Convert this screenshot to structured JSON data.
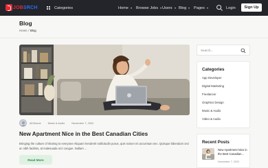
{
  "brand": {
    "logo_text_1": "JOB",
    "logo_text_2": "SRCH"
  },
  "nav": {
    "categories_label": "Categories",
    "items": [
      {
        "label": "Home"
      },
      {
        "label": "Browse Jobs"
      },
      {
        "label": "Users"
      },
      {
        "label": "Blog"
      },
      {
        "label": "Pages"
      }
    ],
    "login_label": "Login",
    "signup_label": "Sign Up"
  },
  "page": {
    "title": "Blog",
    "breadcrumb": {
      "home": "Home",
      "separator": "/",
      "current": "Blog"
    }
  },
  "post": {
    "author": "Ali Boone",
    "category": "Music & Audio",
    "date": "November 7, 2022",
    "title": "New Apartment Nice in the Best Canadian Cities",
    "excerpt": "Bringing the culture of sharing to everyone Aliquam hendrerit sollicitudin purus, quis rutrum mi accumsan nec. Quisque bibendum orci ac nibh facilisis, at malesuada orci congue. Nullam ...",
    "read_more_label": "Read More"
  },
  "sidebar": {
    "search_placeholder": "Search...",
    "categories_title": "Categories",
    "categories": [
      "App Developer",
      "Digital Marketing",
      "Freelancer",
      "Graphics Design",
      "Music & Audio",
      "Video & Audio"
    ],
    "recent_title": "Recent Posts",
    "recent_post": {
      "title": "New Apartment Nice in the Best Canadian...",
      "date": "November 7, 2022"
    }
  }
}
